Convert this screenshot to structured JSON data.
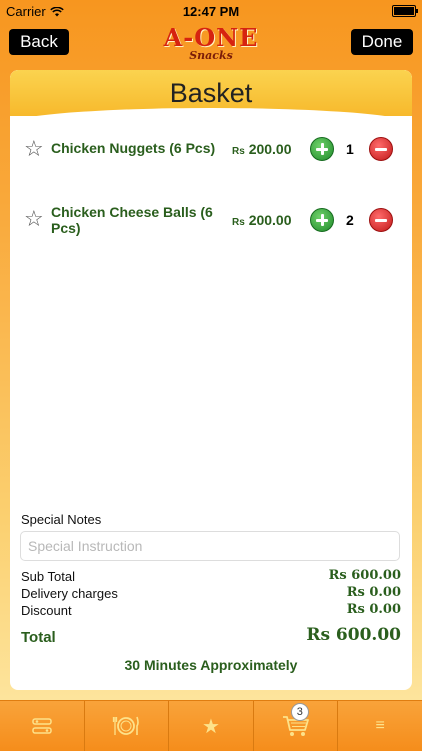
{
  "status_bar": {
    "carrier": "Carrier",
    "time": "12:47 PM"
  },
  "nav": {
    "back_label": "Back",
    "done_label": "Done",
    "logo_main": "A-ONE",
    "logo_sub": "Snacks"
  },
  "basket": {
    "title": "Basket",
    "items": [
      {
        "name": "Chicken Nuggets (6 Pcs)",
        "currency": "Rs",
        "price": "200.00",
        "quantity": "1"
      },
      {
        "name": "Chicken Cheese Balls (6 Pcs)",
        "currency": "Rs",
        "price": "200.00",
        "quantity": "2"
      }
    ],
    "special_notes_label": "Special Notes",
    "special_notes_placeholder": "Special Instruction",
    "sub_total_label": "Sub Total",
    "sub_total_value": "Rs 600.00",
    "delivery_label": "Delivery charges",
    "delivery_value": "Rs 0.00",
    "discount_label": "Discount",
    "discount_value": "Rs 0.00",
    "total_label": "Total",
    "total_value": "Rs 600.00",
    "eta": "30 Minutes Approximately"
  },
  "tabbar": {
    "tabs": [
      {
        "icon": "menu-list-icon"
      },
      {
        "icon": "plate-cutlery-icon"
      },
      {
        "icon": "star-icon"
      },
      {
        "icon": "cart-icon",
        "badge": "3"
      },
      {
        "icon": "hamburger-icon"
      }
    ]
  }
}
